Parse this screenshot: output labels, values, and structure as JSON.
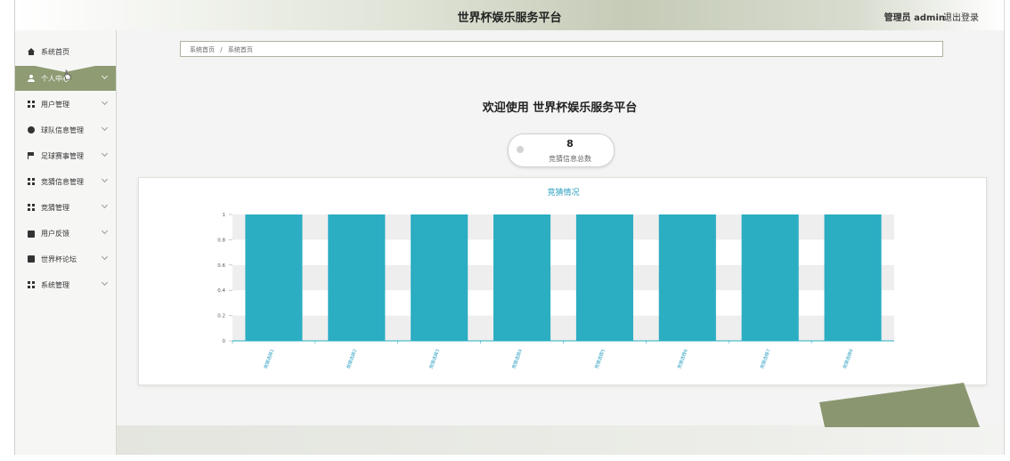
{
  "header": {
    "title": "世界杯娱乐服务平台",
    "user_label": "管理员 admin",
    "logout_label": "退出登录"
  },
  "sidebar": {
    "items": [
      {
        "label": "系统首页",
        "icon": "home-icon"
      },
      {
        "label": "个人中心",
        "icon": "user-icon"
      },
      {
        "label": "用户管理",
        "icon": "grid-icon"
      },
      {
        "label": "球队信息管理",
        "icon": "ball-icon"
      },
      {
        "label": "足球赛事管理",
        "icon": "flag-icon"
      },
      {
        "label": "竞猜信息管理",
        "icon": "grid-icon"
      },
      {
        "label": "竞猜管理",
        "icon": "grid-icon"
      },
      {
        "label": "用户反馈",
        "icon": "thumb-icon"
      },
      {
        "label": "世界杯论坛",
        "icon": "chat-icon"
      },
      {
        "label": "系统管理",
        "icon": "grid-icon"
      }
    ],
    "active_index": 1
  },
  "breadcrumb": {
    "home": "系统首页",
    "separator": "/",
    "current": "系统首页"
  },
  "main": {
    "welcome": "欢迎使用 世界杯娱乐服务平台",
    "stat": {
      "value": "8",
      "label": "竞猜信息总数"
    }
  },
  "colors": {
    "accent": "#8e9b73",
    "bar": "#2badc2",
    "chart_title": "#2a9ec0"
  },
  "chart_data": {
    "type": "bar",
    "title": "竞猜情况",
    "categories": [
      "竞猜选择1",
      "竞猜选择2",
      "竞猜选择3",
      "竞猜选择4",
      "竞猜选择5",
      "竞猜选择6",
      "竞猜选择7",
      "竞猜选择8"
    ],
    "values": [
      1,
      1,
      1,
      1,
      1,
      1,
      1,
      1
    ],
    "yticks": [
      "0",
      "0.2",
      "0.4",
      "0.6",
      "0.8",
      "1"
    ],
    "ylim": [
      0,
      1
    ],
    "xlabel": "",
    "ylabel": ""
  }
}
